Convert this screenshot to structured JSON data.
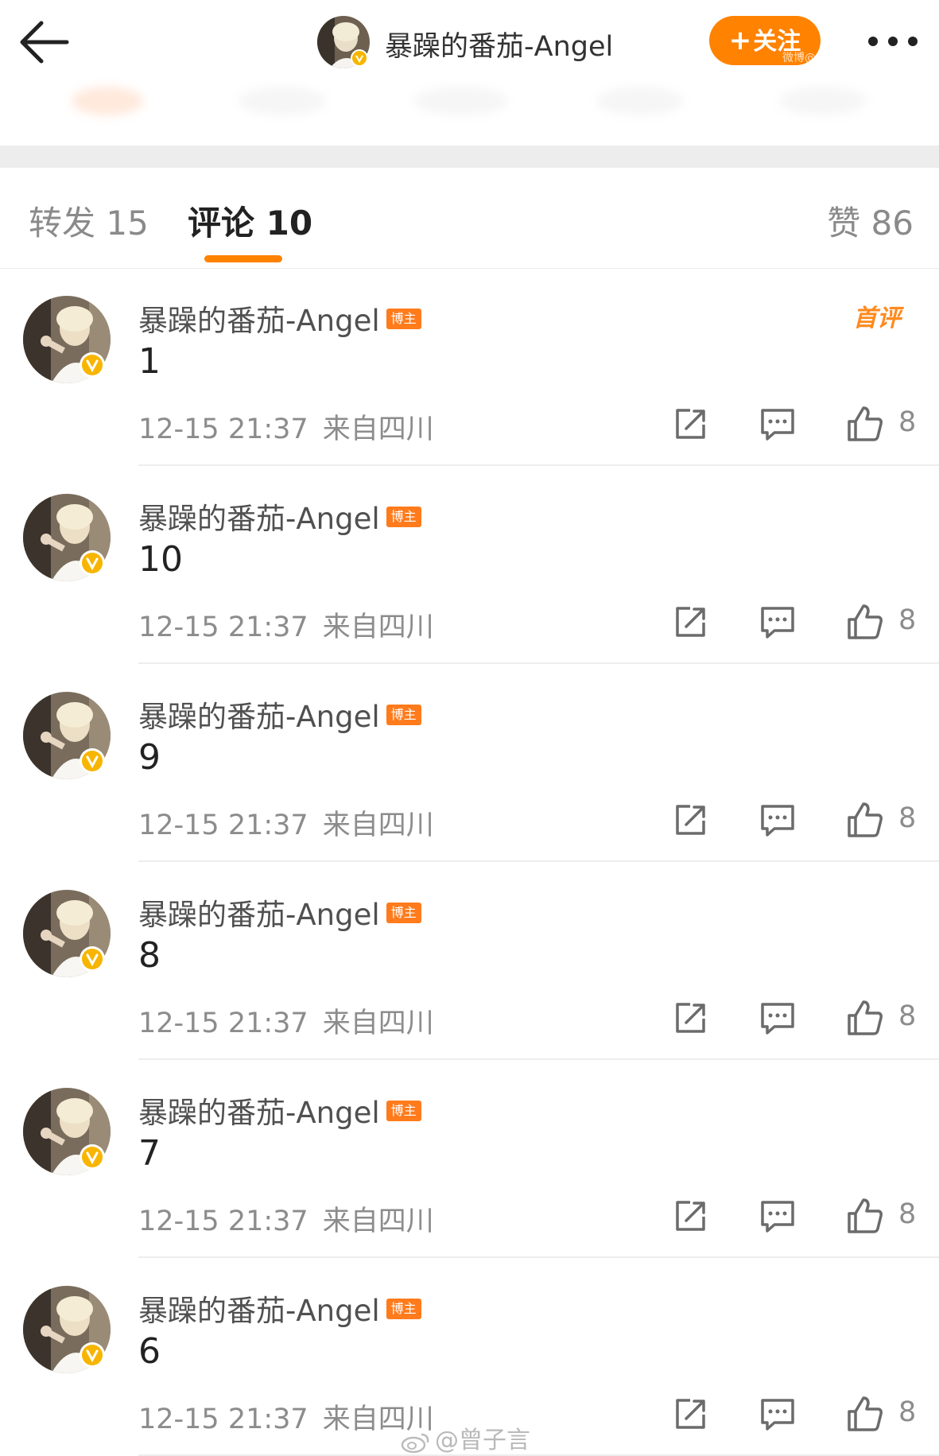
{
  "header": {
    "title": "暴躁的番茄-Angel",
    "follow_label": "关注",
    "follow_watermark": "微博@",
    "accent": "#ff8200"
  },
  "tabs": {
    "repost": "转发 15",
    "comments": "评论 10",
    "likes": "赞 86"
  },
  "comments": [
    {
      "name": "暴躁的番茄-Angel",
      "badge": "博主",
      "tag": "首评",
      "text": "1",
      "date": "12-15 21:37",
      "location": "来自四川",
      "likes": "8"
    },
    {
      "name": "暴躁的番茄-Angel",
      "badge": "博主",
      "tag": "",
      "text": "10",
      "date": "12-15 21:37",
      "location": "来自四川",
      "likes": "8"
    },
    {
      "name": "暴躁的番茄-Angel",
      "badge": "博主",
      "tag": "",
      "text": "9",
      "date": "12-15 21:37",
      "location": "来自四川",
      "likes": "8"
    },
    {
      "name": "暴躁的番茄-Angel",
      "badge": "博主",
      "tag": "",
      "text": "8",
      "date": "12-15 21:37",
      "location": "来自四川",
      "likes": "8"
    },
    {
      "name": "暴躁的番茄-Angel",
      "badge": "博主",
      "tag": "",
      "text": "7",
      "date": "12-15 21:37",
      "location": "来自四川",
      "likes": "8"
    },
    {
      "name": "暴躁的番茄-Angel",
      "badge": "博主",
      "tag": "",
      "text": "6",
      "date": "12-15 21:37",
      "location": "来自四川",
      "likes": "8"
    }
  ],
  "watermark": "@曾子言",
  "icons": {
    "back": "arrow-left-icon",
    "more": "ellipsis-icon",
    "share": "share-icon",
    "reply": "comment-icon",
    "like": "thumbs-up-icon",
    "verified": "verified-badge-icon"
  }
}
